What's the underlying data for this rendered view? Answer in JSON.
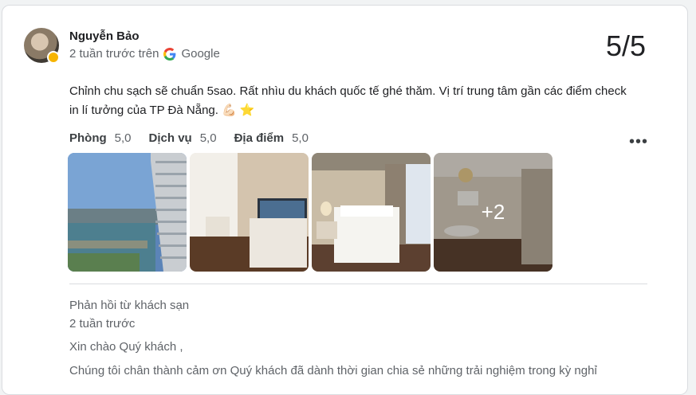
{
  "review": {
    "author": "Nguyễn Bảo",
    "time": "2 tuần trước trên",
    "source": "Google",
    "rating": "5/5",
    "text": "Chỉnh chu sạch sẽ chuẩn 5sao. Rất nhìu du khách quốc tế ghé thăm. Vị trí trung tâm gần các điểm check in lí tưởng của TP Đà Nẵng. 💪🏻 ⭐",
    "sub_ratings": [
      {
        "label": "Phòng",
        "value": "5,0"
      },
      {
        "label": "Dịch vụ",
        "value": "5,0"
      },
      {
        "label": "Địa điểm",
        "value": "5,0"
      }
    ],
    "more_photos": "+2"
  },
  "response": {
    "title": "Phản hồi từ khách sạn",
    "time": "2 tuần trước",
    "greeting": "Xin chào Quý khách ,",
    "body": "Chúng tôi chân thành cảm ơn Quý khách đã dành thời gian chia sẻ những trải nghiệm trong kỳ nghỉ"
  },
  "colors": {
    "star": "#f6b400",
    "google_blue": "#4285f4"
  }
}
